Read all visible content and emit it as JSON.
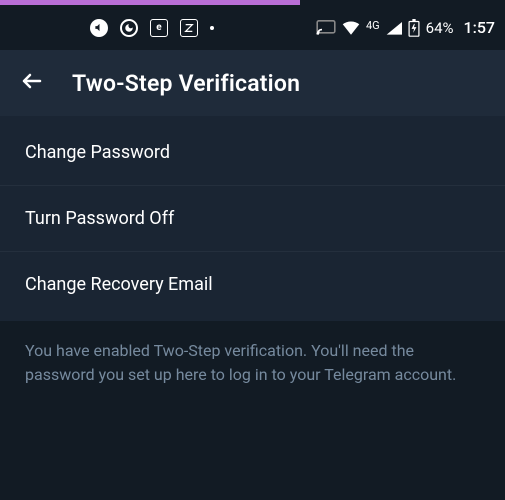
{
  "status": {
    "network_label": "4G",
    "battery_percent": "64%",
    "clock": "1:57"
  },
  "header": {
    "title": "Two-Step Verification"
  },
  "items": [
    {
      "label": "Change Password"
    },
    {
      "label": "Turn Password Off"
    },
    {
      "label": "Change Recovery Email"
    }
  ],
  "footer": "You have enabled Two-Step verification. You'll need the password you set up here to log in to your Telegram account."
}
